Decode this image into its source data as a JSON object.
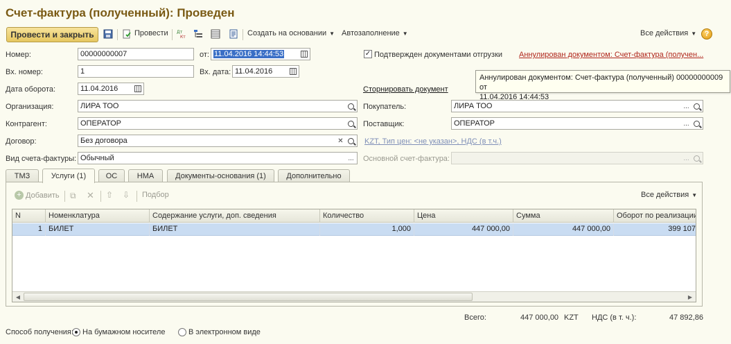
{
  "window": {
    "title": "Счет-фактура (полученный): Проведен"
  },
  "toolbar": {
    "post_close": "Провести и закрыть",
    "post": "Провести",
    "create_based": "Создать на основании",
    "autofill": "Автозаполнение",
    "all_actions": "Все действия",
    "help": "?"
  },
  "form": {
    "number_label": "Номер:",
    "number_value": "00000000007",
    "from_label": "от:",
    "from_value": "11.04.2016 14:44:53",
    "in_number_label": "Вх. номер:",
    "in_number_value": "1",
    "in_date_label": "Вх. дата:",
    "in_date_value": "11.04.2016",
    "turnover_date_label": "Дата оборота:",
    "turnover_date_value": "11.04.2016",
    "org_label": "Организация:",
    "org_value": "ЛИРА ТОО",
    "contractor_label": "Контрагент:",
    "contractor_value": "ОПЕРАТОР",
    "contract_label": "Договор:",
    "contract_value": "Без договора",
    "invoice_kind_label": "Вид счета-фактуры:",
    "invoice_kind_value": "Обычный",
    "confirmed_label": "Подтвержден документами отгрузки",
    "confirmed_checked": true,
    "annulled_link": "Аннулирован документом: Счет-фактура (получен...",
    "storno_link": "Сторнировать документ",
    "buyer_label": "Покупатель:",
    "buyer_value": "ЛИРА ТОО",
    "supplier_label": "Поставщик:",
    "supplier_value": "ОПЕРАТОР",
    "price_link": "KZT, Тип цен: <не указан>, НДС (в т.ч.)",
    "main_invoice_label": "Основной счет-фактура:",
    "main_invoice_value": ""
  },
  "tooltip": {
    "line1": "Аннулирован документом: Счет-фактура (полученный) 00000000009 от",
    "line2": "11.04.2016 14:44:53"
  },
  "tabs": [
    "ТМЗ",
    "Услуги (1)",
    "ОС",
    "НМА",
    "Документы-основания (1)",
    "Дополнительно"
  ],
  "tab_toolbar": {
    "add": "Добавить",
    "pick": "Подбор",
    "all_actions": "Все действия"
  },
  "table": {
    "headers": [
      "N",
      "Номенклатура",
      "Содержание услуги, доп. сведения",
      "Количество",
      "Цена",
      "Сумма",
      "Оборот по реализации"
    ],
    "rows": [
      [
        "1",
        "БИЛЕТ",
        "БИЛЕТ",
        "1,000",
        "447 000,00",
        "447 000,00",
        "399 107"
      ]
    ]
  },
  "totals": {
    "total_label": "Всего:",
    "total_value": "447 000,00",
    "currency": "KZT",
    "vat_label": "НДС (в т. ч.):",
    "vat_value": "47 892,86"
  },
  "receive": {
    "label": "Способ получения:",
    "paper": "На бумажном носителе",
    "electronic": "В электронном виде",
    "selected": "paper"
  },
  "colors": {
    "title": "#7a5a14",
    "link": "#2b54a8",
    "annulled_link": "#b0261c",
    "row_selected": "#c9dcf2"
  }
}
